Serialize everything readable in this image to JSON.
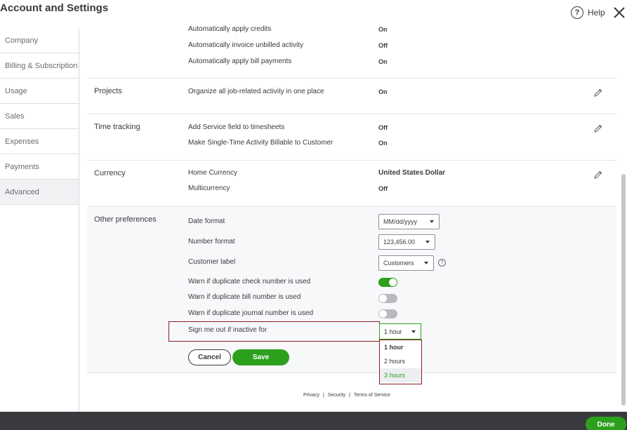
{
  "header": {
    "title": "Account and Settings",
    "help_label": "Help",
    "help_icon": "?"
  },
  "sidebar": {
    "items": [
      {
        "label": "Company"
      },
      {
        "label": "Billing & Subscription"
      },
      {
        "label": "Usage"
      },
      {
        "label": "Sales"
      },
      {
        "label": "Expenses"
      },
      {
        "label": "Payments"
      },
      {
        "label": "Advanced",
        "active": true
      }
    ]
  },
  "sections": {
    "credits": {
      "rows": [
        {
          "label": "Automatically apply credits",
          "value": "On"
        },
        {
          "label": "Automatically invoice unbilled activity",
          "value": "Off"
        },
        {
          "label": "Automatically apply bill payments",
          "value": "On"
        }
      ]
    },
    "projects": {
      "title": "Projects",
      "rows": [
        {
          "label": "Organize all job-related activity in one place",
          "value": "On"
        }
      ]
    },
    "time_tracking": {
      "title": "Time tracking",
      "rows": [
        {
          "label": "Add Service field to timesheets",
          "value": "Off"
        },
        {
          "label": "Make Single-Time Activity Billable to Customer",
          "value": "On"
        }
      ]
    },
    "currency": {
      "title": "Currency",
      "rows": [
        {
          "label": "Home Currency",
          "value": "United States Dollar"
        },
        {
          "label": "Multicurrency",
          "value": "Off"
        }
      ]
    },
    "other": {
      "title": "Other preferences",
      "date_format": {
        "label": "Date format",
        "value": "MM/dd/yyyy"
      },
      "number_format": {
        "label": "Number format",
        "value": "123,456.00"
      },
      "customer_label": {
        "label": "Customer label",
        "value": "Customers",
        "help_icon": "?"
      },
      "warn_check": {
        "label": "Warn if duplicate check number is used",
        "enabled": true
      },
      "warn_bill": {
        "label": "Warn if duplicate bill number is used",
        "enabled": false
      },
      "warn_journal": {
        "label": "Warn if duplicate journal number is used",
        "enabled": false
      },
      "sign_out": {
        "label": "Sign me out if inactive for",
        "value": "1 hour",
        "options": [
          "1 hour",
          "2 hours",
          "3 hours"
        ],
        "selected_index": 0,
        "hover_index": 2
      },
      "cancel_label": "Cancel",
      "save_label": "Save"
    }
  },
  "footer": {
    "privacy": "Privacy",
    "sep": "|",
    "security": "Security",
    "terms": "Terms of Service"
  },
  "bottom": {
    "done_label": "Done"
  },
  "colors": {
    "accent": "#2ca01c",
    "text": "#393a3d",
    "highlight_border": "#8b1d1d",
    "bottom_bar": "#393a3d"
  }
}
